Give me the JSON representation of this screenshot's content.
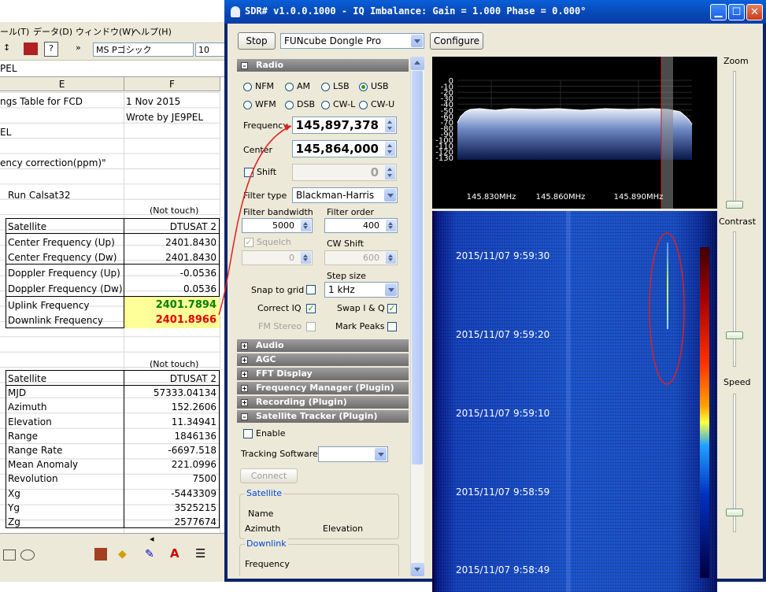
{
  "excel": {
    "menu": [
      "ール(T)",
      "データ(D)",
      "ウィンドウ(W)",
      "ヘルプ(H)"
    ],
    "font_name": "MS Pゴシック",
    "font_size": "10",
    "formula": "PEL",
    "col_e": "E",
    "col_f": "F",
    "cells": {
      "title": "ngs Table for FCD",
      "date": "1 Nov 2015",
      "wrote": "Wrote by JE9PEL",
      "pel": "EL",
      "freq_corr": "ency correction(ppm)\"",
      "run": "Run Calsat32",
      "not_touch_1": "(Not touch)",
      "not_touch_2": "(Not touch)"
    },
    "table1": [
      {
        "label": "Satellite",
        "value": "DTUSAT 2"
      },
      {
        "label": "Center Frequency (Up)",
        "value": "2401.8430"
      },
      {
        "label": "Center Frequency (Dw)",
        "value": "2401.8430"
      },
      {
        "label": "Doppler Frequency (Up)",
        "value": "-0.0536"
      },
      {
        "label": "Doppler Frequency (Dw)",
        "value": "0.0536"
      },
      {
        "label": "Uplink Frequency",
        "value": "2401.7894"
      },
      {
        "label": "Downlink Frequency",
        "value": "2401.8966"
      }
    ],
    "table2": [
      {
        "label": "Satellite",
        "value": "DTUSAT 2"
      },
      {
        "label": "MJD",
        "value": "57333.04134"
      },
      {
        "label": "Azimuth",
        "value": "152.2606"
      },
      {
        "label": "Elevation",
        "value": "11.34941"
      },
      {
        "label": "Range",
        "value": "1846136"
      },
      {
        "label": "Range Rate",
        "value": "-6697.518"
      },
      {
        "label": "Mean Anomaly",
        "value": "221.0996"
      },
      {
        "label": "Revolution",
        "value": "7500"
      },
      {
        "label": "Xg",
        "value": "-5443309"
      },
      {
        "label": "Yg",
        "value": "3525215"
      },
      {
        "label": "Zg",
        "value": "2577674"
      }
    ]
  },
  "sdr": {
    "title": "SDR# v1.0.0.1000 - IQ Imbalance: Gain = 1.000 Phase = 0.000°",
    "stop_label": "Stop",
    "device": "FUNcube Dongle Pro",
    "configure_label": "Configure",
    "sections": {
      "radio": "Radio",
      "audio": "Audio",
      "agc": "AGC",
      "fft": "FFT Display",
      "freqmgr": "Frequency Manager (Plugin)",
      "recording": "Recording (Plugin)",
      "sattrack": "Satellite Tracker (Plugin)"
    },
    "modes": [
      "NFM",
      "AM",
      "LSB",
      "USB",
      "WFM",
      "DSB",
      "CW-L",
      "CW-U"
    ],
    "selected_mode": "USB",
    "frequency_label": "Frequency",
    "frequency": "145,897,378",
    "center_label": "Center",
    "center": "145,864,000",
    "shift_label": "Shift",
    "shift_value": "0",
    "filter_type_label": "Filter type",
    "filter_type": "Blackman-Harris",
    "filter_bw_label": "Filter bandwidth",
    "filter_bw": "5000",
    "filter_order_label": "Filter order",
    "filter_order": "400",
    "squelch_label": "Squelch",
    "squelch_value": "0",
    "cw_shift_label": "CW Shift",
    "cw_shift": "600",
    "step_size_label": "Step size",
    "snap_label": "Snap to grid",
    "step_size": "1 kHz",
    "correct_iq_label": "Correct IQ",
    "swap_iq_label": "Swap I & Q",
    "fm_stereo_label": "FM Stereo",
    "mark_peaks_label": "Mark Peaks",
    "enable_label": "Enable",
    "tracking_label": "Tracking Software",
    "connect_label": "Connect",
    "satellite_group": "Satellite",
    "name_label": "Name",
    "azimuth_label": "Azimuth",
    "elevation_label": "Elevation",
    "downlink_group": "Downlink",
    "dl_frequency_label": "Frequency",
    "spectrum_db": [
      "0",
      "-10",
      "-20",
      "-30",
      "-40",
      "-50",
      "-60",
      "-70",
      "-80",
      "-90",
      "-100",
      "-110",
      "-120",
      "-130"
    ],
    "spectrum_freqs": [
      "145.830MHz",
      "145.860MHz",
      "145.890MHz"
    ],
    "waterfall_times": [
      "2015/11/07 9:59:30",
      "2015/11/07 9:59:20",
      "2015/11/07 9:59:10",
      "2015/11/07 9:58:59",
      "2015/11/07 9:58:49"
    ],
    "zoom_label": "Zoom",
    "contrast_label": "Contrast",
    "speed_label": "Speed"
  }
}
